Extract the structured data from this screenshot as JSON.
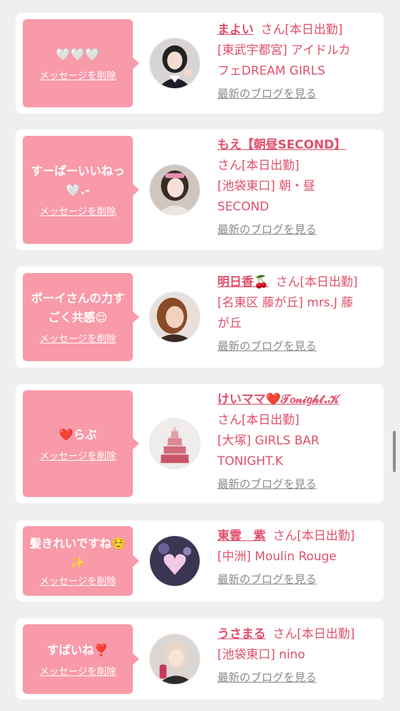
{
  "messages": [
    {
      "message": "🤍🤍🤍",
      "delete_label": "メッセージを削除",
      "name": "まよい",
      "suffix": "さん[本日出勤]",
      "shop_lines": [
        "[東武宇都宮] アイドルカ",
        "フェDREAM GIRLS"
      ],
      "blog_label": "最新のブログを見る"
    },
    {
      "message_lines": [
        "すーぱーいいねっ",
        "🤍.-"
      ],
      "delete_label": "メッセージを削除",
      "name": "もえ【朝昼SECOND】",
      "suffix": "さん[本日出勤]",
      "shop_lines": [
        "[池袋東口] 朝・昼",
        "SECOND"
      ],
      "blog_label": "最新のブログを見る"
    },
    {
      "message_lines": [
        "ボーイさんの力す",
        "ごく共感😌"
      ],
      "delete_label": "メッセージを削除",
      "name": "明日香🍒",
      "suffix": "さん[本日出勤]",
      "shop_lines": [
        "[名東区 藤が丘] mrs.J 藤",
        "が丘"
      ],
      "blog_label": "最新のブログを見る"
    },
    {
      "message": "❤️らぶ",
      "delete_label": "メッセージを削除",
      "name": "けいママ❤️𝒯𝑜𝓃𝒾𝑔𝒽𝓉.𝒦",
      "suffix": "さん[本日出勤]",
      "shop_lines": [
        "[大塚] GIRLS BAR",
        "TONIGHT.K"
      ],
      "blog_label": "最新のブログを見る"
    },
    {
      "message_lines": [
        "髪きれいですね☺️",
        "✨"
      ],
      "delete_label": "メッセージを削除",
      "name": "東雲　紫",
      "suffix": "さん[本日出勤]",
      "shop_lines": [
        "[中洲] Moulin Rouge"
      ],
      "blog_label": "最新のブログを見る"
    },
    {
      "message": "すばいね❣️",
      "delete_label": "メッセージを削除",
      "name": "うさまる",
      "suffix": "さん[本日出勤]",
      "shop_lines": [
        "[池袋東口] nino"
      ],
      "blog_label": "最新のブログを見る"
    }
  ],
  "colors": {
    "accent": "#e0506c",
    "bubble": "#f99aa8",
    "background": "#efefef",
    "link_gray": "#8a8a8a"
  }
}
